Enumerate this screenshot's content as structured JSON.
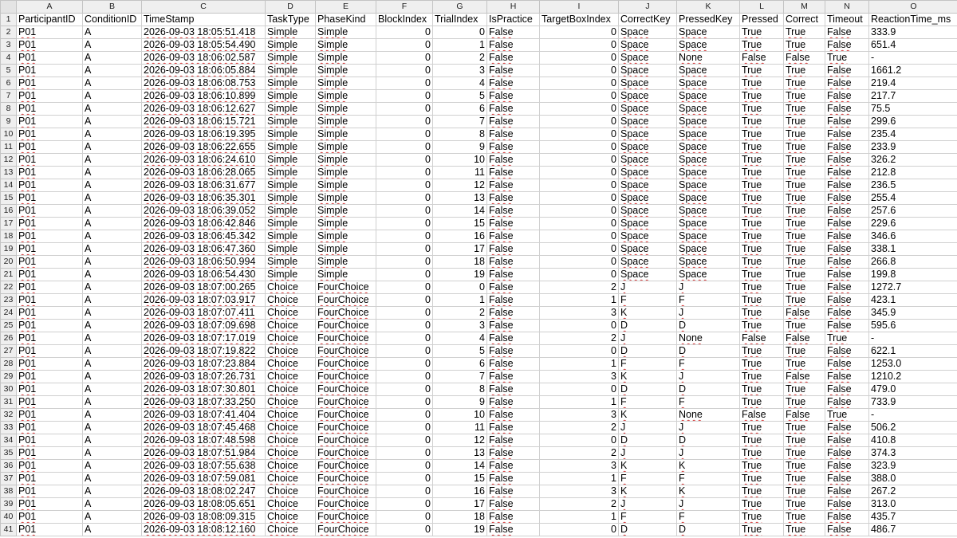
{
  "sheet": {
    "column_letters": [
      "A",
      "B",
      "C",
      "D",
      "E",
      "F",
      "G",
      "H",
      "I",
      "J",
      "K",
      "L",
      "M",
      "N",
      "O"
    ],
    "header_row": [
      "ParticipantID",
      "ConditionID",
      "TimeStamp",
      "TaskType",
      "PhaseKind",
      "BlockIndex",
      "TrialIndex",
      "IsPractice",
      "TargetBoxIndex",
      "CorrectKey",
      "PressedKey",
      "Pressed",
      "Correct",
      "Timeout",
      "ReactionTime_ms"
    ],
    "rows": [
      [
        "P01",
        "A",
        "2026-09-03 18:05:51.418",
        "Simple",
        "Simple",
        "0",
        "0",
        "False",
        "0",
        "Space",
        "Space",
        "True",
        "True",
        "False",
        "333.9"
      ],
      [
        "P01",
        "A",
        "2026-09-03 18:05:54.490",
        "Simple",
        "Simple",
        "0",
        "1",
        "False",
        "0",
        "Space",
        "Space",
        "True",
        "True",
        "False",
        "651.4"
      ],
      [
        "P01",
        "A",
        "2026-09-03 18:06:02.587",
        "Simple",
        "Simple",
        "0",
        "2",
        "False",
        "0",
        "Space",
        "None",
        "False",
        "False",
        "True",
        "-"
      ],
      [
        "P01",
        "A",
        "2026-09-03 18:06:05.884",
        "Simple",
        "Simple",
        "0",
        "3",
        "False",
        "0",
        "Space",
        "Space",
        "True",
        "True",
        "False",
        "1661.2"
      ],
      [
        "P01",
        "A",
        "2026-09-03 18:06:08.753",
        "Simple",
        "Simple",
        "0",
        "4",
        "False",
        "0",
        "Space",
        "Space",
        "True",
        "True",
        "False",
        "219.4"
      ],
      [
        "P01",
        "A",
        "2026-09-03 18:06:10.899",
        "Simple",
        "Simple",
        "0",
        "5",
        "False",
        "0",
        "Space",
        "Space",
        "True",
        "True",
        "False",
        "217.7"
      ],
      [
        "P01",
        "A",
        "2026-09-03 18:06:12.627",
        "Simple",
        "Simple",
        "0",
        "6",
        "False",
        "0",
        "Space",
        "Space",
        "True",
        "True",
        "False",
        "75.5"
      ],
      [
        "P01",
        "A",
        "2026-09-03 18:06:15.721",
        "Simple",
        "Simple",
        "0",
        "7",
        "False",
        "0",
        "Space",
        "Space",
        "True",
        "True",
        "False",
        "299.6"
      ],
      [
        "P01",
        "A",
        "2026-09-03 18:06:19.395",
        "Simple",
        "Simple",
        "0",
        "8",
        "False",
        "0",
        "Space",
        "Space",
        "True",
        "True",
        "False",
        "235.4"
      ],
      [
        "P01",
        "A",
        "2026-09-03 18:06:22.655",
        "Simple",
        "Simple",
        "0",
        "9",
        "False",
        "0",
        "Space",
        "Space",
        "True",
        "True",
        "False",
        "233.9"
      ],
      [
        "P01",
        "A",
        "2026-09-03 18:06:24.610",
        "Simple",
        "Simple",
        "0",
        "10",
        "False",
        "0",
        "Space",
        "Space",
        "True",
        "True",
        "False",
        "326.2"
      ],
      [
        "P01",
        "A",
        "2026-09-03 18:06:28.065",
        "Simple",
        "Simple",
        "0",
        "11",
        "False",
        "0",
        "Space",
        "Space",
        "True",
        "True",
        "False",
        "212.8"
      ],
      [
        "P01",
        "A",
        "2026-09-03 18:06:31.677",
        "Simple",
        "Simple",
        "0",
        "12",
        "False",
        "0",
        "Space",
        "Space",
        "True",
        "True",
        "False",
        "236.5"
      ],
      [
        "P01",
        "A",
        "2026-09-03 18:06:35.301",
        "Simple",
        "Simple",
        "0",
        "13",
        "False",
        "0",
        "Space",
        "Space",
        "True",
        "True",
        "False",
        "255.4"
      ],
      [
        "P01",
        "A",
        "2026-09-03 18:06:39.052",
        "Simple",
        "Simple",
        "0",
        "14",
        "False",
        "0",
        "Space",
        "Space",
        "True",
        "True",
        "False",
        "257.6"
      ],
      [
        "P01",
        "A",
        "2026-09-03 18:06:42.846",
        "Simple",
        "Simple",
        "0",
        "15",
        "False",
        "0",
        "Space",
        "Space",
        "True",
        "True",
        "False",
        "229.6"
      ],
      [
        "P01",
        "A",
        "2026-09-03 18:06:45.342",
        "Simple",
        "Simple",
        "0",
        "16",
        "False",
        "0",
        "Space",
        "Space",
        "True",
        "True",
        "False",
        "346.6"
      ],
      [
        "P01",
        "A",
        "2026-09-03 18:06:47.360",
        "Simple",
        "Simple",
        "0",
        "17",
        "False",
        "0",
        "Space",
        "Space",
        "True",
        "True",
        "False",
        "338.1"
      ],
      [
        "P01",
        "A",
        "2026-09-03 18:06:50.994",
        "Simple",
        "Simple",
        "0",
        "18",
        "False",
        "0",
        "Space",
        "Space",
        "True",
        "True",
        "False",
        "266.8"
      ],
      [
        "P01",
        "A",
        "2026-09-03 18:06:54.430",
        "Simple",
        "Simple",
        "0",
        "19",
        "False",
        "0",
        "Space",
        "Space",
        "True",
        "True",
        "False",
        "199.8"
      ],
      [
        "P01",
        "A",
        "2026-09-03 18:07:00.265",
        "Choice",
        "FourChoice",
        "0",
        "0",
        "False",
        "2",
        "J",
        "J",
        "True",
        "True",
        "False",
        "1272.7"
      ],
      [
        "P01",
        "A",
        "2026-09-03 18:07:03.917",
        "Choice",
        "FourChoice",
        "0",
        "1",
        "False",
        "1",
        "F",
        "F",
        "True",
        "True",
        "False",
        "423.1"
      ],
      [
        "P01",
        "A",
        "2026-09-03 18:07:07.411",
        "Choice",
        "FourChoice",
        "0",
        "2",
        "False",
        "3",
        "K",
        "J",
        "True",
        "False",
        "False",
        "345.9"
      ],
      [
        "P01",
        "A",
        "2026-09-03 18:07:09.698",
        "Choice",
        "FourChoice",
        "0",
        "3",
        "False",
        "0",
        "D",
        "D",
        "True",
        "True",
        "False",
        "595.6"
      ],
      [
        "P01",
        "A",
        "2026-09-03 18:07:17.019",
        "Choice",
        "FourChoice",
        "0",
        "4",
        "False",
        "2",
        "J",
        "None",
        "False",
        "False",
        "True",
        "-"
      ],
      [
        "P01",
        "A",
        "2026-09-03 18:07:19.822",
        "Choice",
        "FourChoice",
        "0",
        "5",
        "False",
        "0",
        "D",
        "D",
        "True",
        "True",
        "False",
        "622.1"
      ],
      [
        "P01",
        "A",
        "2026-09-03 18:07:23.884",
        "Choice",
        "FourChoice",
        "0",
        "6",
        "False",
        "1",
        "F",
        "F",
        "True",
        "True",
        "False",
        "1253.0"
      ],
      [
        "P01",
        "A",
        "2026-09-03 18:07:26.731",
        "Choice",
        "FourChoice",
        "0",
        "7",
        "False",
        "3",
        "K",
        "J",
        "True",
        "False",
        "False",
        "1210.2"
      ],
      [
        "P01",
        "A",
        "2026-09-03 18:07:30.801",
        "Choice",
        "FourChoice",
        "0",
        "8",
        "False",
        "0",
        "D",
        "D",
        "True",
        "True",
        "False",
        "479.0"
      ],
      [
        "P01",
        "A",
        "2026-09-03 18:07:33.250",
        "Choice",
        "FourChoice",
        "0",
        "9",
        "False",
        "1",
        "F",
        "F",
        "True",
        "True",
        "False",
        "733.9"
      ],
      [
        "P01",
        "A",
        "2026-09-03 18:07:41.404",
        "Choice",
        "FourChoice",
        "0",
        "10",
        "False",
        "3",
        "K",
        "None",
        "False",
        "False",
        "True",
        "-"
      ],
      [
        "P01",
        "A",
        "2026-09-03 18:07:45.468",
        "Choice",
        "FourChoice",
        "0",
        "11",
        "False",
        "2",
        "J",
        "J",
        "True",
        "True",
        "False",
        "506.2"
      ],
      [
        "P01",
        "A",
        "2026-09-03 18:07:48.598",
        "Choice",
        "FourChoice",
        "0",
        "12",
        "False",
        "0",
        "D",
        "D",
        "True",
        "True",
        "False",
        "410.8"
      ],
      [
        "P01",
        "A",
        "2026-09-03 18:07:51.984",
        "Choice",
        "FourChoice",
        "0",
        "13",
        "False",
        "2",
        "J",
        "J",
        "True",
        "True",
        "False",
        "374.3"
      ],
      [
        "P01",
        "A",
        "2026-09-03 18:07:55.638",
        "Choice",
        "FourChoice",
        "0",
        "14",
        "False",
        "3",
        "K",
        "K",
        "True",
        "True",
        "False",
        "323.9"
      ],
      [
        "P01",
        "A",
        "2026-09-03 18:07:59.081",
        "Choice",
        "FourChoice",
        "0",
        "15",
        "False",
        "1",
        "F",
        "F",
        "True",
        "True",
        "False",
        "388.0"
      ],
      [
        "P01",
        "A",
        "2026-09-03 18:08:02.247",
        "Choice",
        "FourChoice",
        "0",
        "16",
        "False",
        "3",
        "K",
        "K",
        "True",
        "True",
        "False",
        "267.2"
      ],
      [
        "P01",
        "A",
        "2026-09-03 18:08:05.651",
        "Choice",
        "FourChoice",
        "0",
        "17",
        "False",
        "2",
        "J",
        "J",
        "True",
        "True",
        "False",
        "313.0"
      ],
      [
        "P01",
        "A",
        "2026-09-03 18:08:09.315",
        "Choice",
        "FourChoice",
        "0",
        "18",
        "False",
        "1",
        "F",
        "F",
        "True",
        "True",
        "False",
        "435.7"
      ],
      [
        "P01",
        "A",
        "2026-09-03 18:08:12.160",
        "Choice",
        "FourChoice",
        "0",
        "19",
        "False",
        "0",
        "D",
        "D",
        "True",
        "True",
        "False",
        "486.7"
      ]
    ]
  }
}
